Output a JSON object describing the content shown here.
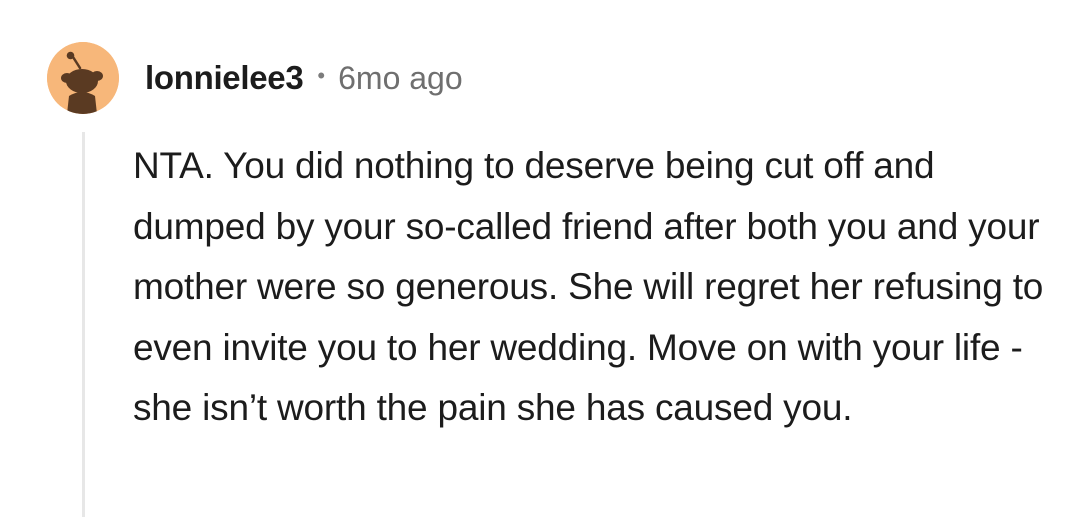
{
  "comment": {
    "avatar_icon": "reddit-snoo-avatar-icon",
    "avatar_bg": "#f7b77a",
    "username": "lonnielee3",
    "separator": "•",
    "timestamp": "6mo ago",
    "body": "NTA. You did nothing to deserve being cut off and dumped by your so-called friend after both you and your mother were so generous. She will regret her refusing to even invite you to her wedding. Move on with your life - she isn’t worth the pain she has caused you."
  }
}
